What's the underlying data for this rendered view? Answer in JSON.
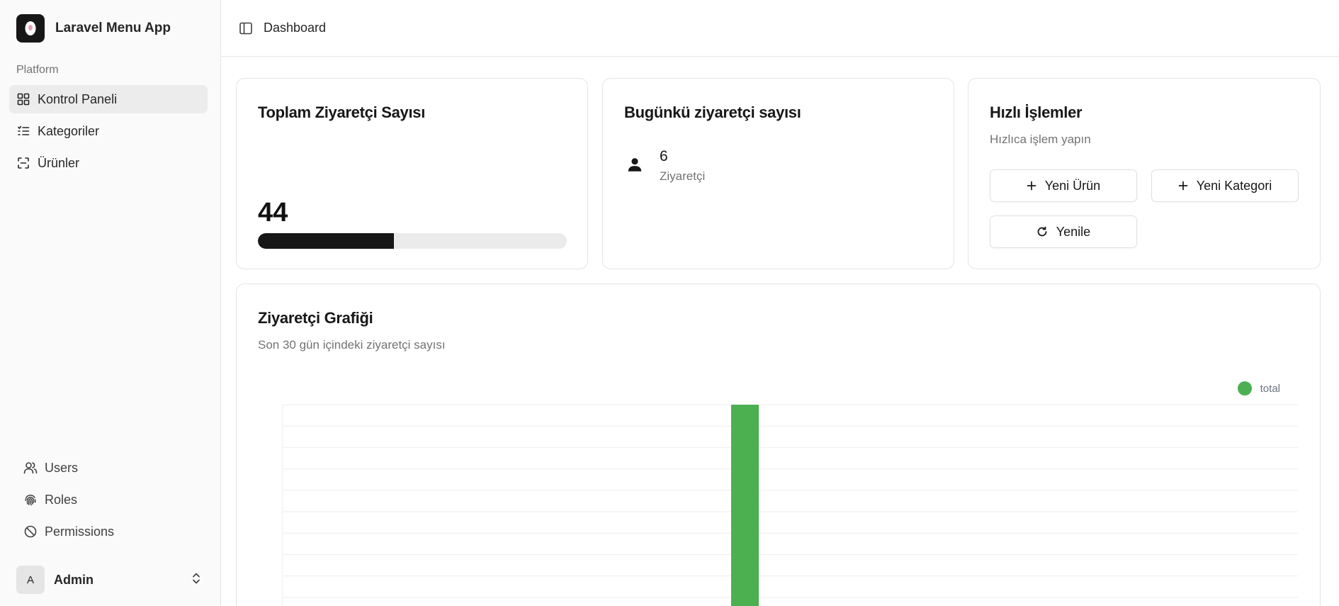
{
  "app": {
    "name": "Laravel Menu App"
  },
  "sidebar": {
    "section_label": "Platform",
    "items": [
      {
        "label": "Kontrol Paneli",
        "icon": "grid-icon",
        "active": true
      },
      {
        "label": "Kategoriler",
        "icon": "list-icon",
        "active": false
      },
      {
        "label": "Ürünler",
        "icon": "scan-icon",
        "active": false
      }
    ],
    "bottom_items": [
      {
        "label": "Users",
        "icon": "users-icon"
      },
      {
        "label": "Roles",
        "icon": "fingerprint-icon"
      },
      {
        "label": "Permissions",
        "icon": "ban-icon"
      }
    ],
    "user": {
      "initial": "A",
      "name": "Admin"
    }
  },
  "header": {
    "title": "Dashboard"
  },
  "cards": {
    "total": {
      "title": "Toplam Ziyaretçi Sayısı",
      "value": "44",
      "progress_percent": 44
    },
    "today": {
      "title": "Bugünkü ziyaretçi sayısı",
      "value": "6",
      "label": "Ziyaretçi"
    },
    "quick": {
      "title": "Hızlı İşlemler",
      "subtitle": "Hızlıca işlem yapın",
      "new_product": "Yeni Ürün",
      "new_category": "Yeni Kategori",
      "refresh": "Yenile"
    }
  },
  "chart": {
    "title": "Ziyaretçi Grafiği",
    "subtitle": "Son 30 gün içindeki ziyaretçi sayısı"
  },
  "colors": {
    "accent": "#4caf50",
    "dark": "#171717"
  },
  "chart_data": {
    "type": "bar",
    "series": [
      {
        "name": "total",
        "color": "#4caf50",
        "values": [
          0,
          0,
          0,
          0,
          0,
          0,
          0,
          0,
          0,
          0,
          0,
          0,
          0,
          0,
          0,
          1,
          0,
          0,
          0,
          0,
          0,
          0,
          0,
          0,
          0,
          0,
          0,
          0,
          0,
          0
        ]
      }
    ],
    "categories_count": 30,
    "grid": true,
    "legend": "top-right",
    "ylim": [
      0,
      1
    ]
  }
}
